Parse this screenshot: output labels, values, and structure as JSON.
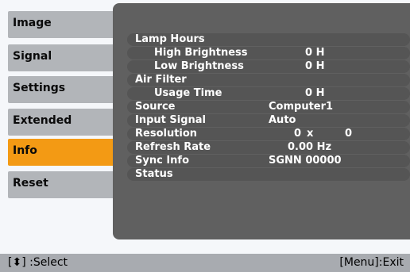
{
  "menu": {
    "tabs": [
      "Image",
      "Signal",
      "Settings",
      "Extended",
      "Info",
      "Reset"
    ],
    "active": "Info"
  },
  "info": {
    "lamp_hours": "Lamp Hours",
    "high_brightness_label": "High Brightness",
    "high_brightness_value": "0 H",
    "low_brightness_label": "Low Brightness",
    "low_brightness_value": "0 H",
    "air_filter": "Air Filter",
    "usage_time_label": "Usage Time",
    "usage_time_value": "0 H",
    "source_label": "Source",
    "source_value": "Computer1",
    "input_signal_label": "Input Signal",
    "input_signal_value": "Auto",
    "resolution_label": "Resolution",
    "resolution_w": "0",
    "resolution_x": "x",
    "resolution_h": "0",
    "refresh_rate_label": "Refresh Rate",
    "refresh_rate_value": "0.00 Hz",
    "sync_info_label": "Sync Info",
    "sync_info_value": "SGNN 00000",
    "status_label": "Status"
  },
  "footer": {
    "select_hint": "[⬍] :Select",
    "exit_hint": "[Menu]:Exit"
  },
  "colors": {
    "active_tab": "#f39a14",
    "inactive_tab": "#b2b5b9",
    "panel": "#606060"
  }
}
